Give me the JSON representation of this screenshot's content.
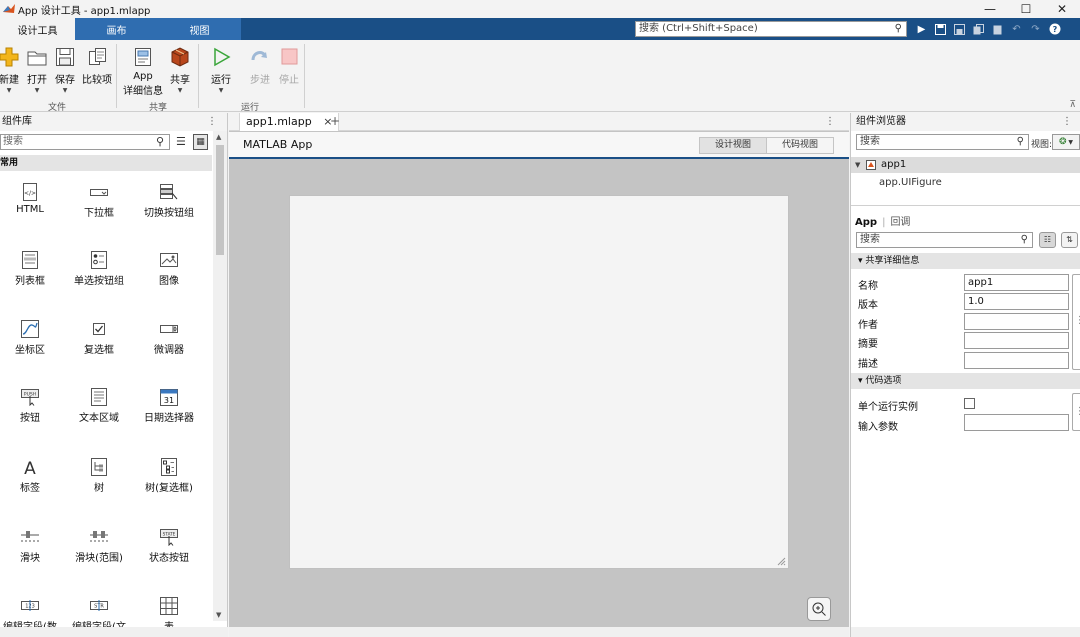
{
  "window": {
    "title": "App 设计工具 - app1.mlapp",
    "controls": [
      "—",
      "☐",
      "✕"
    ]
  },
  "tabs": [
    "设计工具",
    "画布",
    "视图"
  ],
  "search": {
    "placeholder": "搜索 (Ctrl+Shift+Space)"
  },
  "quick_access": [
    "run-icon",
    "save-icon",
    "save-all-icon",
    "copy-icon",
    "paste-icon",
    "undo-icon",
    "redo-icon",
    "help-icon"
  ],
  "ribbon": {
    "file": {
      "new": "新建",
      "open": "打开",
      "save": "保存",
      "compare": "比较项",
      "label": "文件"
    },
    "share": {
      "app_details_1": "App",
      "app_details_2": "详细信息",
      "share": "共享",
      "label": "共享"
    },
    "run": {
      "run": "运行",
      "step": "步进",
      "stop": "停止",
      "label": "运行"
    }
  },
  "left_panel": {
    "title": "组件库",
    "search_placeholder": "搜索",
    "section": "常用",
    "components": [
      {
        "label": "HTML",
        "icon": "html-icon"
      },
      {
        "label": "下拉框",
        "icon": "dropdown-icon"
      },
      {
        "label": "切换按钮组",
        "icon": "toggle-button-group-icon"
      },
      {
        "label": "列表框",
        "icon": "listbox-icon"
      },
      {
        "label": "单选按钮组",
        "icon": "radio-button-group-icon"
      },
      {
        "label": "图像",
        "icon": "image-icon"
      },
      {
        "label": "坐标区",
        "icon": "axes-icon"
      },
      {
        "label": "复选框",
        "icon": "checkbox-icon"
      },
      {
        "label": "微调器",
        "icon": "spinner-icon"
      },
      {
        "label": "按钮",
        "icon": "button-icon"
      },
      {
        "label": "文本区域",
        "icon": "text-area-icon"
      },
      {
        "label": "日期选择器",
        "icon": "date-picker-icon"
      },
      {
        "label": "标签",
        "icon": "label-icon"
      },
      {
        "label": "树",
        "icon": "tree-icon"
      },
      {
        "label": "树(复选框)",
        "icon": "checkbox-tree-icon"
      },
      {
        "label": "滑块",
        "icon": "slider-icon"
      },
      {
        "label": "滑块(范围)",
        "icon": "range-slider-icon"
      },
      {
        "label": "状态按钮",
        "icon": "state-button-icon"
      },
      {
        "label": "编辑字段(数",
        "icon": "numeric-edit-field-icon"
      },
      {
        "label": "编辑字段(文",
        "icon": "text-edit-field-icon"
      },
      {
        "label": "表",
        "icon": "table-icon"
      }
    ],
    "icon_texts": {
      "button": "PUSH",
      "date": "31",
      "label_a": "A",
      "numeric": "123",
      "text_field": "STR",
      "state": "STATE"
    }
  },
  "document": {
    "tab": "app1.mlapp",
    "close": "×",
    "add": "+",
    "app_title": "MATLAB App",
    "design_view": "设计视图",
    "code_view": "代码视图"
  },
  "right_panel": {
    "title": "组件浏览器",
    "search_placeholder": "搜索",
    "view_label": "视图:",
    "tree_root": "app1",
    "tree_child": "app.UIFigure",
    "inspector_tabs": {
      "app": "App",
      "callbacks": "回调"
    },
    "inspector_search_placeholder": "搜索",
    "sections": {
      "shared": "▾ 共享详细信息",
      "code": "▾ 代码选项"
    },
    "props": {
      "name_label": "名称",
      "name_value": "app1",
      "version_label": "版本",
      "version_value": "1.0",
      "author_label": "作者",
      "summary_label": "摘要",
      "description_label": "描述",
      "single_instance_label": "单个运行实例",
      "input_args_label": "输入参数"
    }
  },
  "colors": {
    "accent_blue": "#1a4f86",
    "tab_blue": "#2f6db0",
    "run_green": "#3aa53a"
  }
}
